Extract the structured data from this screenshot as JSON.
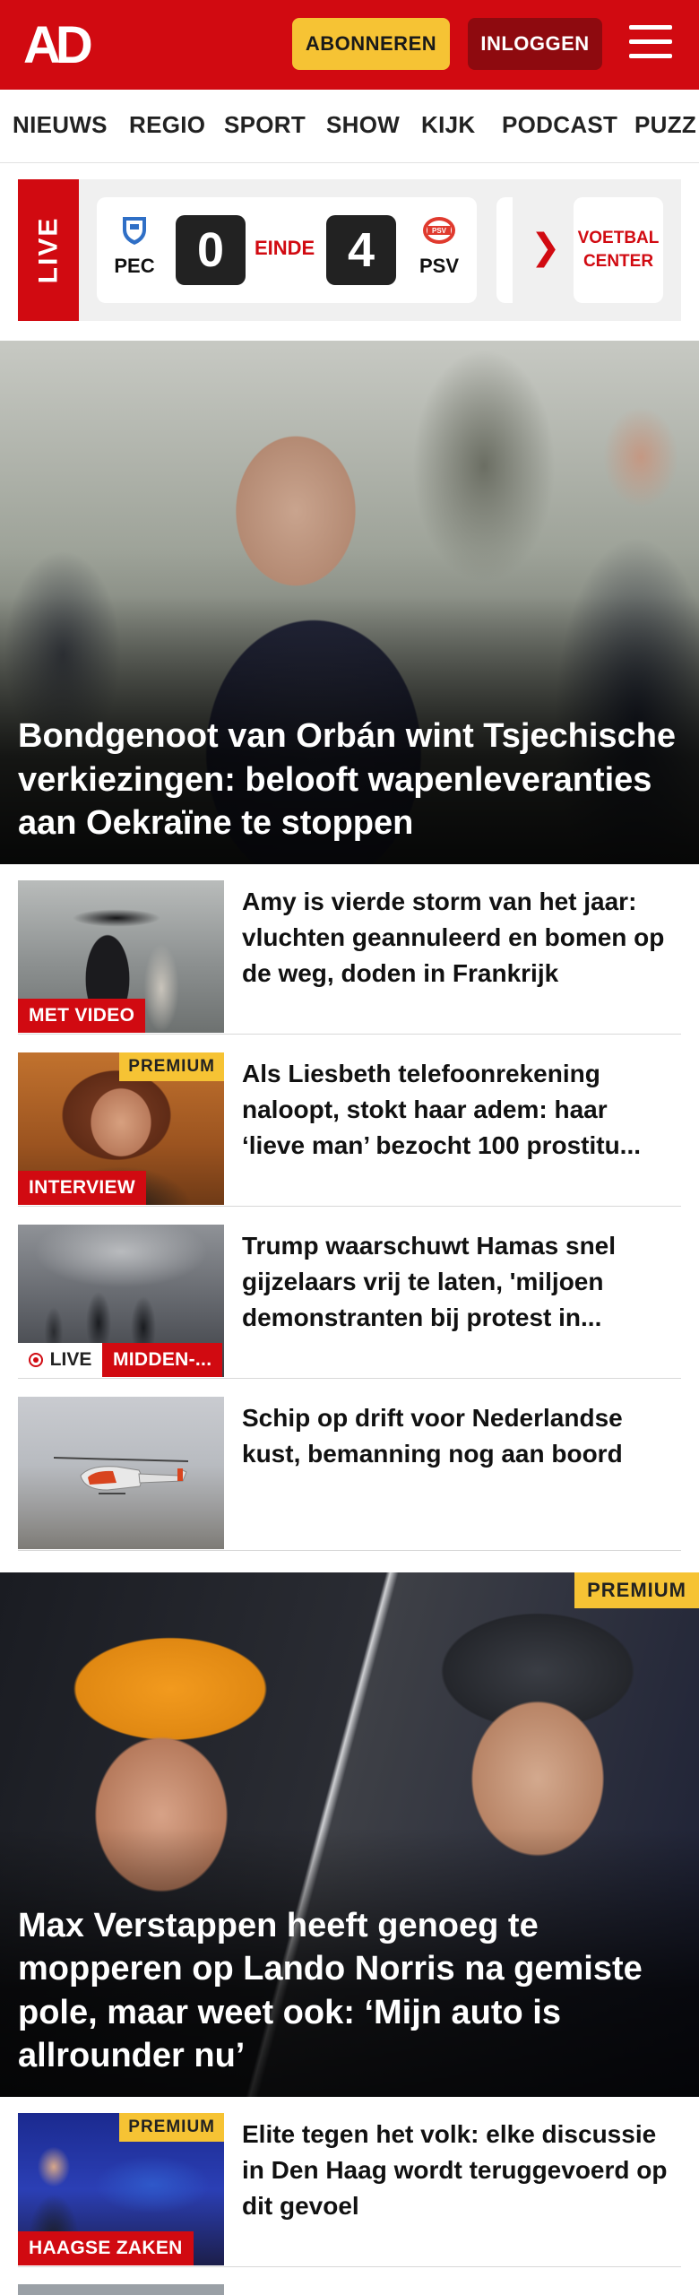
{
  "header": {
    "logo": "AD",
    "subscribe_label": "ABONNEREN",
    "login_label": "INLOGGEN",
    "brand_color": "#d10a11",
    "subscribe_color": "#f6c334"
  },
  "nav": {
    "items": [
      "NIEUWS",
      "REGIO",
      "SPORT",
      "SHOW",
      "KIJK",
      "PODCAST",
      "PUZZ"
    ]
  },
  "live": {
    "tab_label": "LIVE",
    "match": {
      "home_team": "PEC",
      "away_team": "PSV",
      "home_score": "0",
      "away_score": "4",
      "status": "EINDE"
    },
    "voetbal_center_label": "VOETBAL CENTER"
  },
  "hero": {
    "title": "Bondgenoot van Orbán wint Tsjechi­sche verkiezingen: belooft wapenleveranties aan Oekraïne te stoppen"
  },
  "articles": [
    {
      "title": "Amy is vierde storm van het jaar: vluchten geannuleerd en bomen op de weg, doden in Frankrijk",
      "label": "MET VIDEO"
    },
    {
      "title": "Als Liesbeth telefoonrekening naloopt, stokt haar adem: haar ‘lieve man’ bezocht 100 prostitu...",
      "label": "INTERVIEW",
      "badge": "PREMIUM"
    },
    {
      "title": "Trump waarschuwt Hamas snel gijzelaars vrij te laten, 'miljoen demonstranten bij protest in...",
      "live_label": "LIVE",
      "label": "MIDDEN-..."
    },
    {
      "title": "Schip op drift voor Nederlandse kust, bemanning nog aan boord"
    }
  ],
  "hero2": {
    "badge": "PREMIUM",
    "title": "Max Verstappen heeft genoeg te mopperen op Lando Norris na gemiste pole, maar weet ook: ‘Mijn auto is allrounder nu’"
  },
  "articles2": [
    {
      "title": "Elite tegen het volk: elke discussie in Den Haag wordt teruggevoerd op dit gevoel",
      "label": "HAAGSE ZAKEN",
      "badge": "PREMIUM"
    }
  ]
}
